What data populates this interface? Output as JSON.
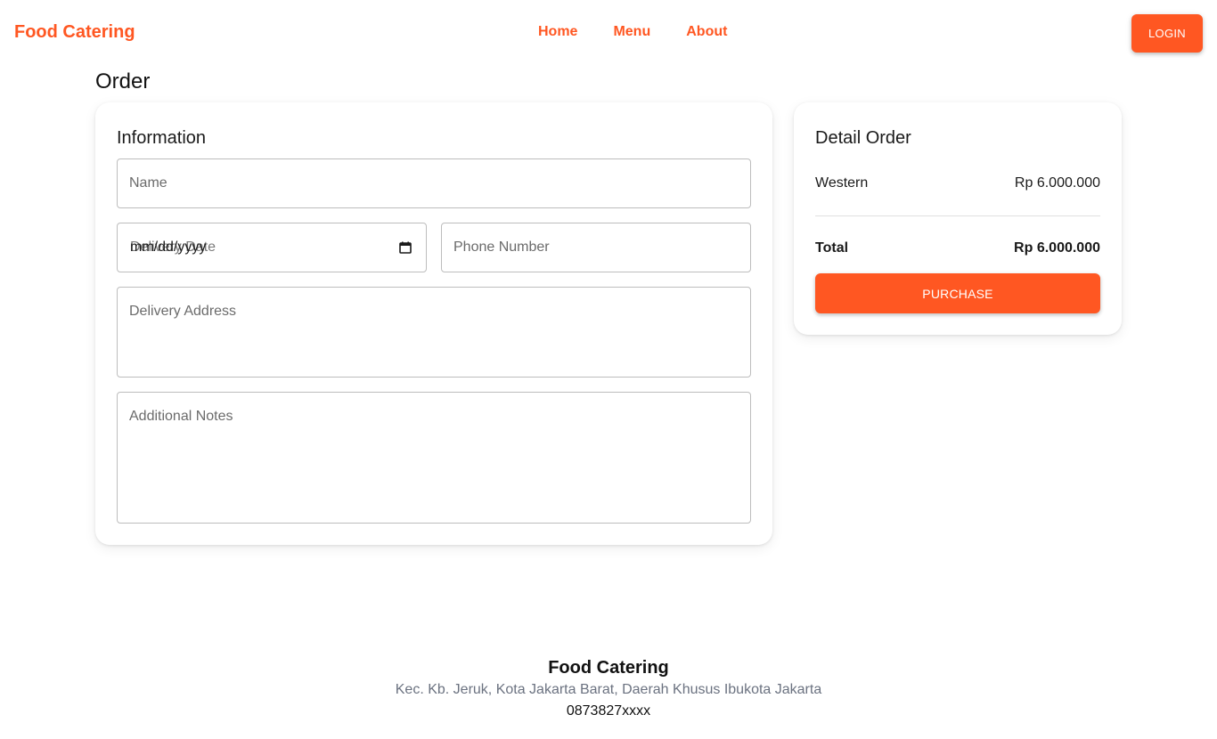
{
  "colors": {
    "accent": "#ff5722"
  },
  "nav": {
    "brand": "Food Catering",
    "links": [
      "Home",
      "Menu",
      "About"
    ],
    "login_label": "LOGIN"
  },
  "page": {
    "title": "Order"
  },
  "information": {
    "title": "Information",
    "name_placeholder": "Name",
    "delivery_date_label": "Delivery Date",
    "delivery_date_value": "mm/dd/yyyy",
    "phone_placeholder": "Phone Number",
    "address_placeholder": "Delivery Address",
    "notes_placeholder": "Additional Notes",
    "calendar_icon": "calendar-icon"
  },
  "detail": {
    "title": "Detail Order",
    "items": [
      {
        "name": "Western",
        "price": "Rp 6.000.000"
      }
    ],
    "total_label": "Total",
    "total_value": "Rp 6.000.000",
    "purchase_label": "PURCHASE"
  },
  "footer": {
    "brand": "Food Catering",
    "address": "Kec. Kb. Jeruk, Kota Jakarta Barat, Daerah Khusus Ibukota Jakarta",
    "phone": "0873827xxxx"
  }
}
